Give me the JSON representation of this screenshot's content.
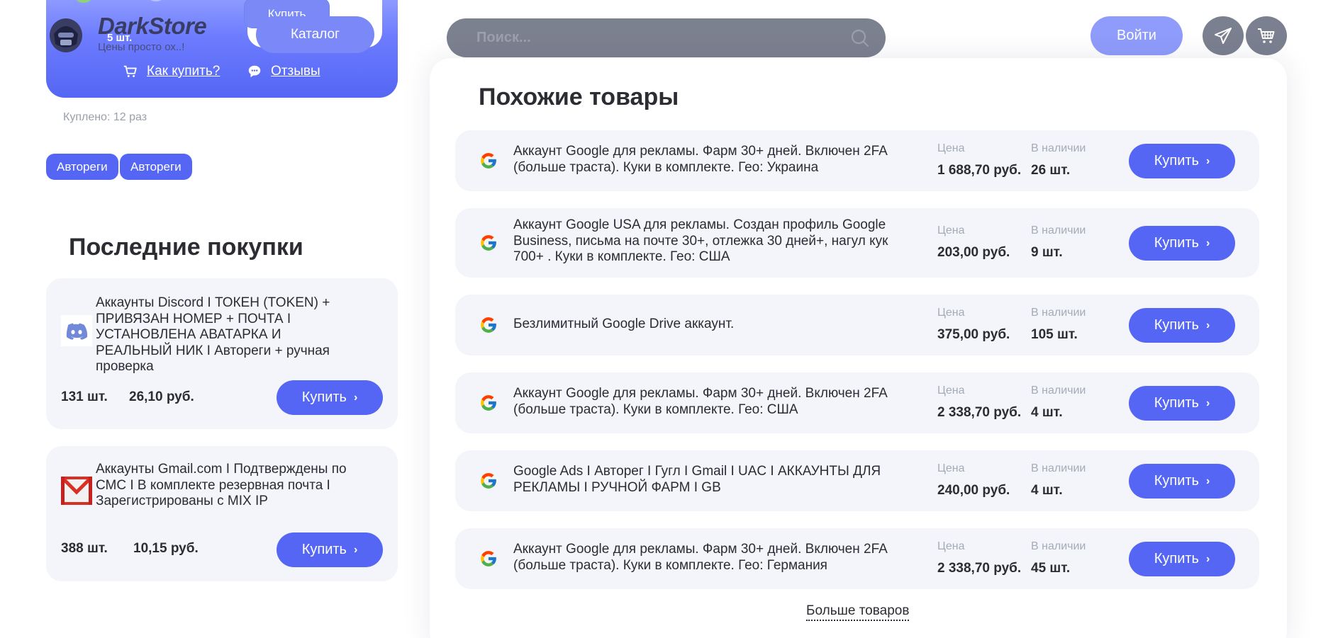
{
  "brand": {
    "name": "DarkStore",
    "qty": "5 шт.",
    "tagline": "Цены просто ох..!",
    "ghost_buy": "Купить",
    "catalog": "Каталог",
    "how_to_buy": "Как купить?",
    "reviews": "Отзывы"
  },
  "bought": "Куплено: 12 раз",
  "tags": [
    "Автореги",
    "Автореги"
  ],
  "recent": {
    "title": "Последние покупки",
    "items": [
      {
        "icon": "discord-icon",
        "title": "Аккаунты Discord I ТОКЕН (TOKEN) + ПРИВЯЗАН НОМЕР + ПОЧТА I УСТАНОВЛЕНА АВАТАРКА И РЕАЛЬНЫЙ НИК I Автореги + ручная проверка",
        "qty": "131 шт.",
        "price": "26,10 руб.",
        "buy": "Купить"
      },
      {
        "icon": "gmail-icon",
        "title": "Аккаунты Gmail.com I Подтверждены по СМС I В комплекте резервная почта I Зарегистрированы с MIX IP",
        "qty": "388 шт.",
        "price": "10,15 руб.",
        "buy": "Купить"
      }
    ]
  },
  "search": {
    "placeholder": "Поиск..."
  },
  "login": "Войти",
  "similar": {
    "title": "Похожие товары",
    "price_label": "Цена",
    "stock_label": "В наличии",
    "buy_label": "Купить",
    "items": [
      {
        "title": "Аккаунт Google для рекламы. Фарм 30+ дней. Включен 2FA (больше траста). Куки в комплекте. Гео: Украина",
        "price": "1 688,70 руб.",
        "stock": "26 шт."
      },
      {
        "title": "Аккаунт Google USA для рекламы. Создан профиль Google Business, письма на почте 30+, отлежка 30 дней+, нагул кук 700+ . Куки в комплекте. Гео: США",
        "price": "203,00 руб.",
        "stock": "9 шт."
      },
      {
        "title": "Безлимитный Google Drive аккаунт.",
        "price": "375,00 руб.",
        "stock": "105 шт."
      },
      {
        "title": "Аккаунт Google для рекламы. Фарм 30+ дней. Включен 2FA (больше траста). Куки в комплекте. Гео: США",
        "price": "2 338,70 руб.",
        "stock": "4 шт."
      },
      {
        "title": "Google Ads I Автoрег I Гугл I Gmail I UAC I АККАУНТЫ ДЛЯ РЕКЛАМЫ I РУЧНОЙ ФАРМ I GB",
        "price": "240,00 руб.",
        "stock": "4 шт."
      },
      {
        "title": "Аккаунт Google для рекламы. Фарм 30+ дней. Включен 2FA (больше траста). Куки в комплекте. Гео: Германия",
        "price": "2 338,70 руб.",
        "stock": "45 шт."
      }
    ],
    "more": "Больше товаров"
  },
  "colors": {
    "accent": "#5466f3",
    "card_bg": "#f3f5fb",
    "search_bg": "#7c8190"
  }
}
